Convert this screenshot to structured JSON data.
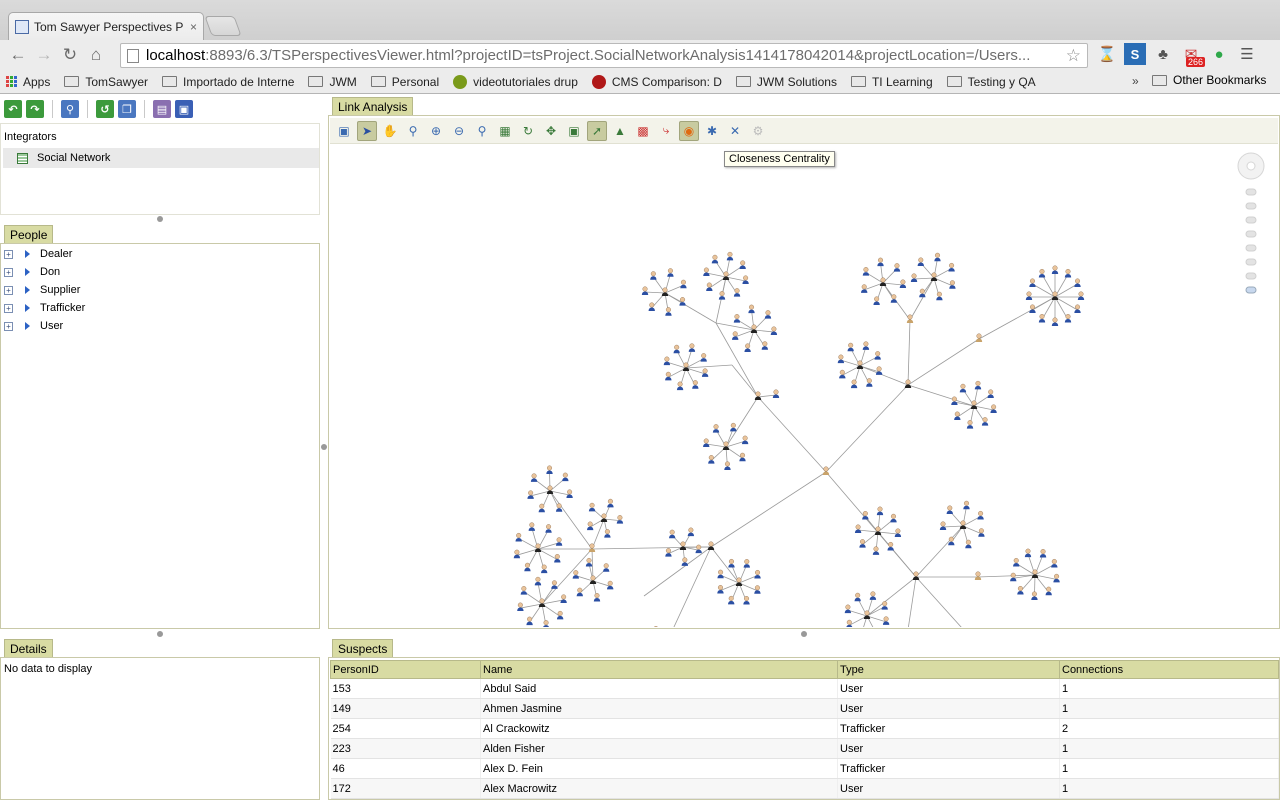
{
  "browser": {
    "tab_title": "Tom Sawyer Perspectives P",
    "tab_close": "×",
    "url_host": "localhost",
    "url_rest": ":8893/6.3/TSPerspectivesViewer.html?projectID=tsProject.SocialNetworkAnalysis1414178042014&projectLocation=/Users...",
    "bookmarks": [
      {
        "label": "Apps",
        "kind": "apps"
      },
      {
        "label": "TomSawyer",
        "kind": "folder"
      },
      {
        "label": "Importado de Interne",
        "kind": "folder"
      },
      {
        "label": "JWM",
        "kind": "folder"
      },
      {
        "label": "Personal",
        "kind": "folder"
      },
      {
        "label": "videotutoriales drup",
        "kind": "site",
        "color": "#7a9a1a"
      },
      {
        "label": "CMS Comparison: D",
        "kind": "site",
        "color": "#b01818"
      },
      {
        "label": "JWM Solutions",
        "kind": "folder"
      },
      {
        "label": "TI Learning",
        "kind": "folder"
      },
      {
        "label": "Testing y QA",
        "kind": "folder"
      }
    ],
    "bookmarks_more": "»",
    "other_bookmarks": "Other Bookmarks",
    "extension_badge": "266"
  },
  "integrators": {
    "label": "Integrators",
    "items": [
      "Social Network"
    ]
  },
  "people": {
    "tab": "People",
    "items": [
      "Dealer",
      "Don",
      "Supplier",
      "Trafficker",
      "User"
    ]
  },
  "link_analysis": {
    "tab": "Link Analysis",
    "tooltip": "Closeness Centrality"
  },
  "details": {
    "tab": "Details",
    "empty": "No data to display"
  },
  "suspects": {
    "tab": "Suspects",
    "columns": [
      "PersonID",
      "Name",
      "Type",
      "Connections"
    ],
    "rows": [
      [
        "153",
        "Abdul Said",
        "User",
        "1"
      ],
      [
        "149",
        "Ahmen Jasmine",
        "User",
        "1"
      ],
      [
        "254",
        "Al Crackowitz",
        "Trafficker",
        "2"
      ],
      [
        "223",
        "Alden Fisher",
        "User",
        "1"
      ],
      [
        "46",
        "Alex D. Fein",
        "Trafficker",
        "1"
      ],
      [
        "172",
        "Alex Macrowitz",
        "User",
        "1"
      ]
    ]
  },
  "colors": {
    "panel_tab": "#d8dba3",
    "node_user": "#2b4fa3",
    "node_dealer": "#c9a36a",
    "edge": "#9a9a9a"
  }
}
